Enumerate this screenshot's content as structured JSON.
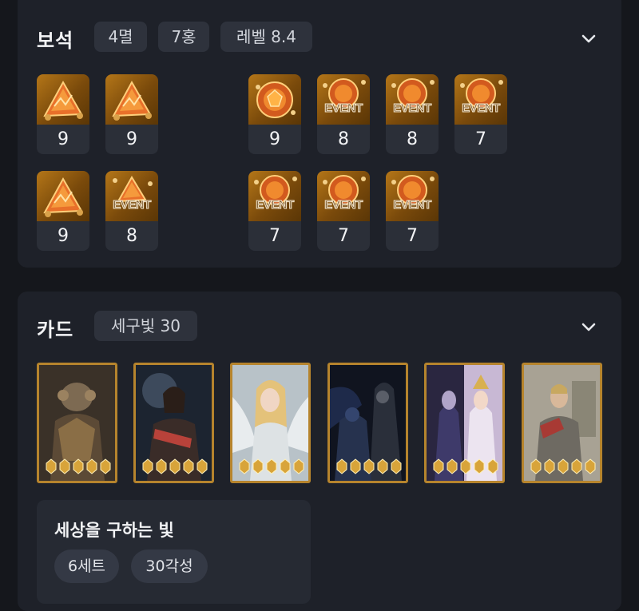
{
  "gems": {
    "title": "보석",
    "tags": [
      "4멸",
      "7홍",
      "레벨 8.4"
    ],
    "event_label": "EVENT",
    "levels_row1": [
      "9",
      "9",
      "9",
      "8",
      "8",
      "7"
    ],
    "levels_row2": [
      "9",
      "8",
      "7",
      "7",
      "7"
    ]
  },
  "cards": {
    "title": "카드",
    "tags": [
      "세구빛 30"
    ],
    "set": {
      "name": "세상을 구하는 빛",
      "pills": [
        "6세트",
        "30각성"
      ]
    }
  },
  "icons": [
    "chevron-down-icon",
    "gem-icon",
    "card-portrait",
    "awakening-gem-icon"
  ],
  "colors": {
    "background": "#15171c",
    "panel": "#1e2129",
    "chip": "#2e323c",
    "gem_gold": "#b47618",
    "card_border": "#b6842d"
  }
}
